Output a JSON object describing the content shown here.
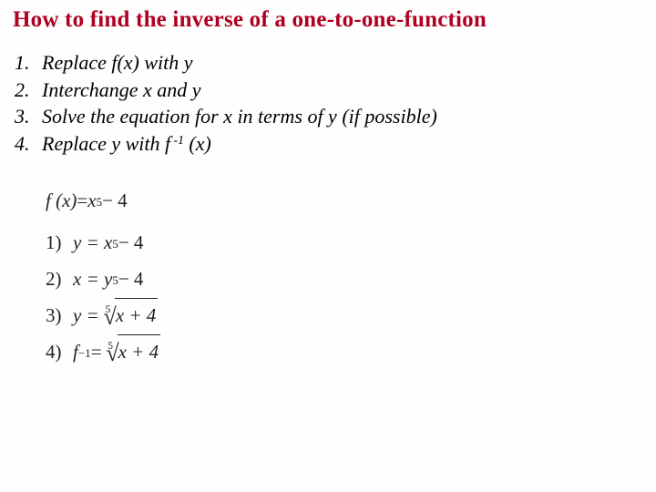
{
  "title": "How to find the inverse of a one-to-one-function",
  "steps": {
    "n1": "1.",
    "n2": "2.",
    "n3": "3.",
    "n4": "4.",
    "s1": "Replace f(x) with y",
    "s2": "Interchange x and y",
    "s3": "Solve the equation for x in terms of y (if possible)",
    "s4_pre": "Replace y with f",
    "s4_exp": " -1",
    "s4_post": " (x)"
  },
  "example": {
    "given_lhs": "f (x)",
    "given_eq": " = ",
    "given_rhs_base": "x",
    "given_rhs_exp": "5",
    "given_rhs_tail": " − 4",
    "l1": "1)",
    "l2": "2)",
    "l3": "3)",
    "l4": "4)",
    "e1_lhs": "y = x",
    "e1_exp": "5",
    "e1_tail": " − 4",
    "e2_lhs": "x = y",
    "e2_exp": "5",
    "e2_tail": " − 4",
    "e3_lhs": "y = ",
    "root_index": "5",
    "radicand": "x + 4",
    "e4_f": "f",
    "e4_exp": " −1",
    "e4_mid": " = "
  }
}
